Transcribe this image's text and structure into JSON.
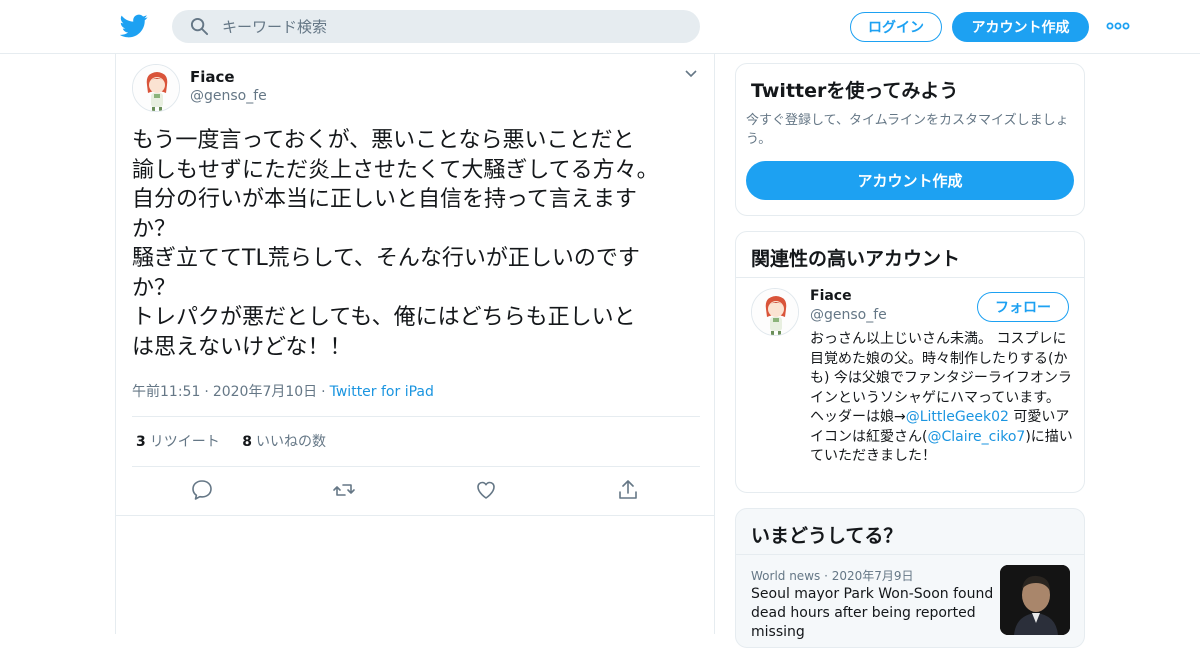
{
  "header": {
    "search_placeholder": "キーワード検索",
    "login_label": "ログイン",
    "signup_label": "アカウント作成",
    "brand_color": "#1da1f2"
  },
  "tweet": {
    "author_name": "Fiace",
    "author_handle": "@genso_fe",
    "text": "もう一度言っておくが、悪いことなら悪いことだと\n諭しもせずにただ炎上させたくて大騒ぎしてる方々。\n自分の行いが本当に正しいと自信を持って言えます\nか？\n騒ぎ立ててTL荒らして、そんな行いが正しいのです\nか？\nトレパクが悪だとしても、俺にはどちらも正しいと\nは思えないけどな！！",
    "time": "午前11:51",
    "separator": "·",
    "date": "2020年7月10日",
    "source": "Twitter for iPad",
    "retweet_count": "3",
    "retweet_label": "リツイート",
    "like_count": "8",
    "like_label": "いいねの数"
  },
  "sidebar": {
    "signup_card": {
      "title": "Twitterを使ってみよう",
      "subtitle": "今すぐ登録して、タイムラインをカスタマイズしましょう。",
      "button_label": "アカウント作成"
    },
    "related": {
      "title": "関連性の高いアカウント",
      "name": "Fiace",
      "handle": "@genso_fe",
      "follow_label": "フォロー",
      "bio_part1": "おっさん以上じいさん未満。 コスプレに目覚めた娘の父。時々制作したりする(かも) 今は父娘でファンタジーライフオンラインというソシャゲにハマっています。 ヘッダーは娘→",
      "bio_link1": "@LittleGeek02",
      "bio_part2": " 可愛いアイコンは紅愛さん(",
      "bio_link2": "@Claire_ciko7",
      "bio_part3": ")に描いていただきました！"
    },
    "trends": {
      "title": "いまどうしてる？",
      "category": "World news",
      "separator": "·",
      "date": "2020年7月9日",
      "headline": "Seoul mayor Park Won-Soon found dead hours after being reported missing"
    }
  }
}
